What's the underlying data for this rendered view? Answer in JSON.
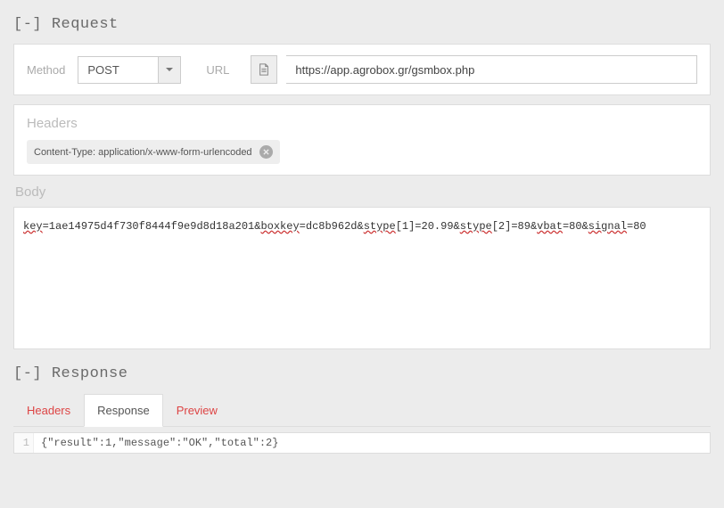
{
  "request": {
    "title_prefix": "[-]",
    "title": "Request",
    "method_label": "Method",
    "method_value": "POST",
    "url_label": "URL",
    "url_value": "https://app.agrobox.gr/gsmbox.php",
    "headers_title": "Headers",
    "header_chip": "Content-Type: application/x-www-form-urlencoded",
    "body_title": "Body",
    "body_parts": [
      {
        "t": "u",
        "v": "key"
      },
      {
        "t": "n",
        "v": "=1ae14975d4f730f8444f9e9d8d18a201&"
      },
      {
        "t": "u",
        "v": "boxkey"
      },
      {
        "t": "n",
        "v": "=dc8b962d&"
      },
      {
        "t": "u",
        "v": "stype"
      },
      {
        "t": "n",
        "v": "[1]=20.99&"
      },
      {
        "t": "u",
        "v": "stype"
      },
      {
        "t": "n",
        "v": "[2]=89&"
      },
      {
        "t": "u",
        "v": "vbat"
      },
      {
        "t": "n",
        "v": "=80&"
      },
      {
        "t": "u",
        "v": "signal"
      },
      {
        "t": "n",
        "v": "=80"
      }
    ]
  },
  "response": {
    "title_prefix": "[-]",
    "title": "Response",
    "tabs": [
      {
        "label": "Headers",
        "active": false
      },
      {
        "label": "Response",
        "active": true
      },
      {
        "label": "Preview",
        "active": false
      }
    ],
    "line_number": "1",
    "code": "{\"result\":1,\"message\":\"OK\",\"total\":2}"
  }
}
